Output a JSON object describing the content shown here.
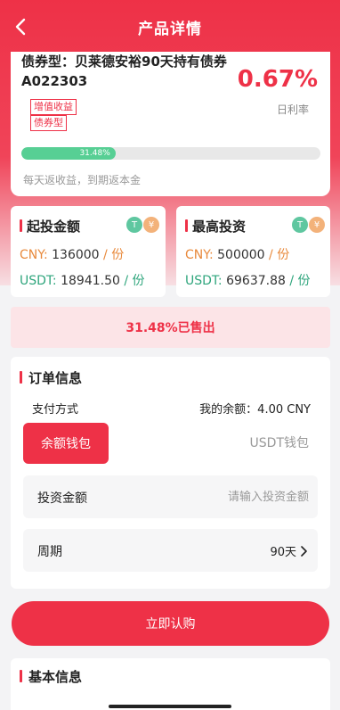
{
  "header": {
    "title": "产品详情"
  },
  "product": {
    "name": "债券型：贝莱德安裕90天持有债券A022303",
    "rate": "0.67%",
    "rate_label": "日利率",
    "tags": [
      "增值收益",
      "债券型"
    ],
    "progress_text": "31.48%",
    "progress_value": 0.3148,
    "return_note": "每天返收益，到期返本金"
  },
  "min_invest": {
    "title": "起投金额",
    "coin_t": "T",
    "coin_r": "¥",
    "cny_label": "CNY:",
    "cny_value": "136000",
    "cny_unit": "/ 份",
    "usdt_label": "USDT:",
    "usdt_value": "18941.50",
    "usdt_unit": "/ 份"
  },
  "max_invest": {
    "title": "最高投资",
    "coin_t": "T",
    "coin_r": "¥",
    "cny_label": "CNY:",
    "cny_value": "500000",
    "cny_unit": "/ 份",
    "usdt_label": "USDT:",
    "usdt_value": "69637.88",
    "usdt_unit": "/ 份"
  },
  "sold": {
    "text": "31.48%已售出"
  },
  "order": {
    "title": "订单信息",
    "pay_label": "支付方式",
    "balance": "我的余额：4.00 CNY",
    "pay_balance": "余额钱包",
    "pay_usdt": "USDT钱包",
    "amount_label": "投资金额",
    "amount_placeholder": "请输入投资金额",
    "period_label": "周期",
    "period_value": "90天"
  },
  "buy_button": "立即认购",
  "basic": {
    "title": "基本信息"
  },
  "colors": {
    "accent": "#ee3147",
    "green": "#57cf94",
    "orange": "#e8893b"
  }
}
